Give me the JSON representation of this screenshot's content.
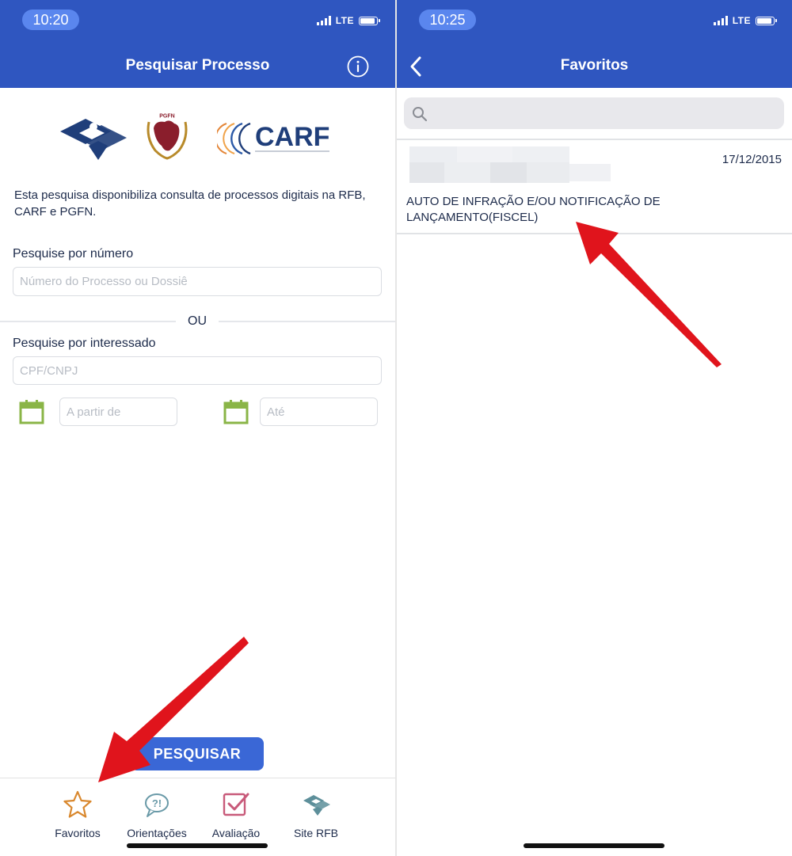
{
  "left": {
    "status": {
      "time": "10:20",
      "network": "LTE"
    },
    "header": {
      "title": "Pesquisar Processo"
    },
    "logos": {
      "carf_text": "CARF",
      "pgfn_text": "PGFN"
    },
    "intro": "Esta pesquisa disponibiliza consulta de processos digitais na RFB, CARF e PGFN.",
    "search_number": {
      "label": "Pesquise por número",
      "placeholder": "Número do Processo ou Dossiê"
    },
    "or_text": "OU",
    "search_party": {
      "label": "Pesquise por interessado",
      "placeholder": "CPF/CNPJ",
      "from_placeholder": "A partir de",
      "to_placeholder": "Até"
    },
    "search_button": "PESQUISAR",
    "tabs": [
      {
        "label": "Favoritos",
        "icon": "star-icon"
      },
      {
        "label": "Orientações",
        "icon": "speech-bubble-icon"
      },
      {
        "label": "Avaliação",
        "icon": "checkbox-icon"
      },
      {
        "label": "Site RFB",
        "icon": "rfb-logo-icon"
      }
    ]
  },
  "right": {
    "status": {
      "time": "10:25",
      "network": "LTE"
    },
    "header": {
      "title": "Favoritos"
    },
    "search": {
      "placeholder": ""
    },
    "favorites": [
      {
        "date": "17/12/2015",
        "title": "AUTO DE INFRAÇÃO E/OU NOTIFICAÇÃO DE LANÇAMENTO(FISCEL)"
      }
    ]
  },
  "colors": {
    "header_blue": "#2f56c0",
    "button_blue": "#3a67d6",
    "calendar_green": "#8ab547",
    "arrow_red": "#e0141c"
  }
}
